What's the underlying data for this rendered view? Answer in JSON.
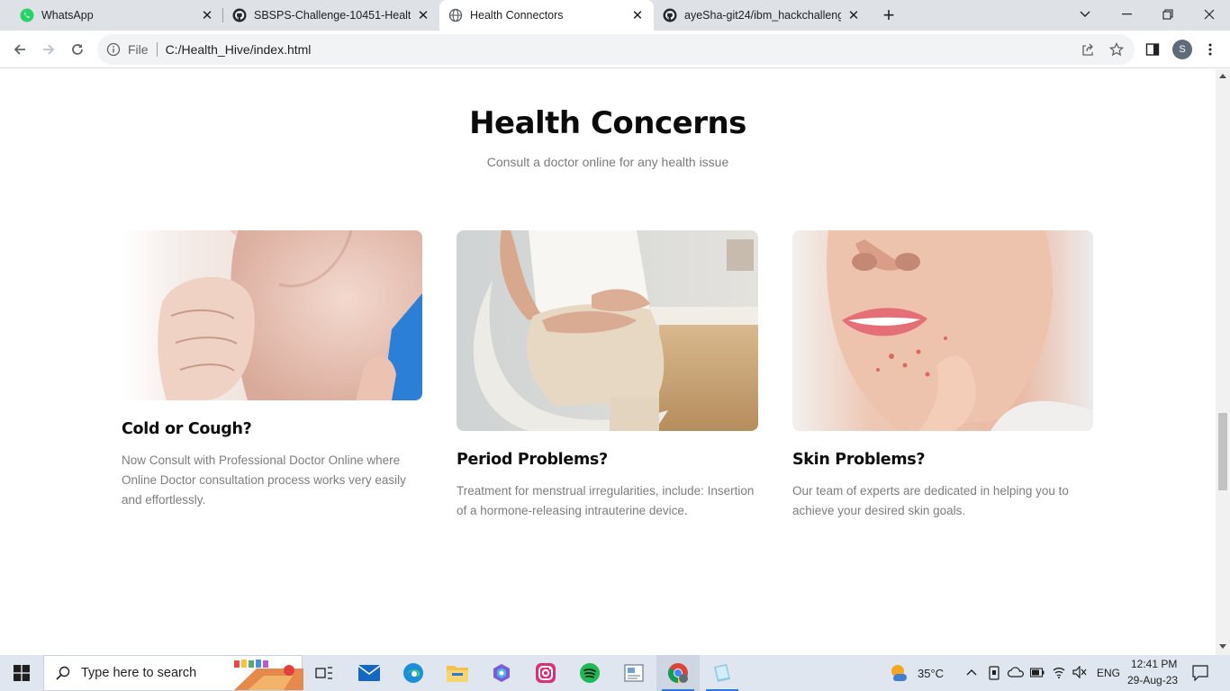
{
  "browser": {
    "tabs": [
      {
        "title": "WhatsApp",
        "icon": "whatsapp-icon",
        "active": false
      },
      {
        "title": "SBSPS-Challenge-10451-HealthC",
        "icon": "github-icon",
        "active": false
      },
      {
        "title": "Health Connectors",
        "icon": "globe-icon",
        "active": true
      },
      {
        "title": "ayeSha-git24/ibm_hackchallenge",
        "icon": "github-icon",
        "active": false
      }
    ],
    "omnibox": {
      "scheme_label": "File",
      "url": "C:/Health_Hive/index.html"
    },
    "profile_initial": "S"
  },
  "page": {
    "heading": "Health Concerns",
    "subheading": "Consult a doctor online for any health issue",
    "cards": [
      {
        "title": "Cold or Cough?",
        "text": "Now Consult with Professional Doctor Online where Online Doctor consultation process works very easily and effortlessly.",
        "image": "person-coughing-photo"
      },
      {
        "title": "Period Problems?",
        "text": "Treatment for menstrual irregularities, include: Insertion of a hormone-releasing intrauterine device.",
        "image": "person-holding-abdomen-photo"
      },
      {
        "title": "Skin Problems?",
        "text": "Our team of experts are dedicated in helping you to achieve your desired skin goals.",
        "image": "face-acne-closeup-photo"
      }
    ]
  },
  "taskbar": {
    "search_placeholder": "Type here to search",
    "weather": "35°C",
    "language": "ENG",
    "time": "12:41 PM",
    "date": "29-Aug-23"
  },
  "colors": {
    "accent": "#2b79d8",
    "heading": "#0b0b0b",
    "body_text": "#7d7d7d"
  }
}
